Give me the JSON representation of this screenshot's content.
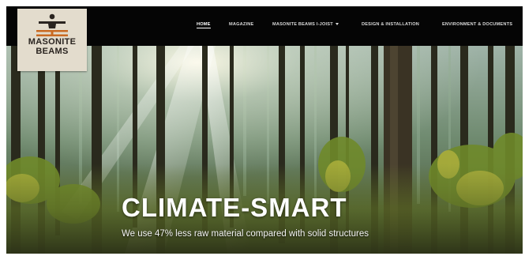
{
  "logo": {
    "line1": "MASONITE",
    "line2": "BEAMS",
    "icon": "person-beam-icon"
  },
  "nav": {
    "items": [
      {
        "label": "HOME",
        "active": true
      },
      {
        "label": "MAGAZINE"
      },
      {
        "label": "MASONITE BEAMS I-JOIST",
        "dropdown": true
      },
      {
        "label": "DESIGN & INSTALLATION"
      },
      {
        "label": "ENVIRONMENT & DOCUMENTS"
      }
    ]
  },
  "hero": {
    "title": "CLIMATE-SMART",
    "subtitle": "We use 47% less raw material compared with solid structures",
    "background": "sunlit-forest-image"
  },
  "colors": {
    "navbar": "#050505",
    "logo_bg": "#e3dccd",
    "logo_text": "#2a2420",
    "logo_beam": "#c96a22",
    "hero_text": "#ffffff"
  }
}
